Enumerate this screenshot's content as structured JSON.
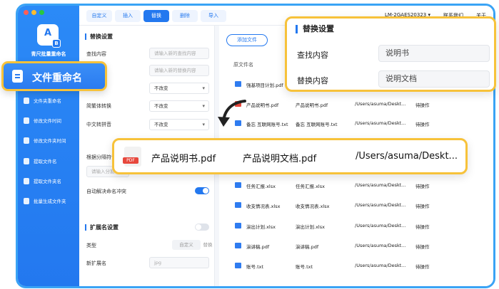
{
  "colors": {
    "accent": "#2378ef",
    "highlight": "#f7c23a",
    "frame": "#3aa3f5",
    "pdf": "#e7483d"
  },
  "window": {
    "dots": [
      "#ff5f57",
      "#febc2e",
      "#28c840"
    ]
  },
  "sidebar": {
    "app_name": "青尺批量重命名",
    "logo_letter": "A",
    "logo_sub": "B",
    "items": [
      {
        "label": "文件夹重命名",
        "icon": "folder-icon"
      },
      {
        "label": "修改文件时间",
        "icon": "clock-icon"
      },
      {
        "label": "修改文件夹时间",
        "icon": "clock-icon"
      },
      {
        "label": "提取文件名",
        "icon": "extract-icon"
      },
      {
        "label": "提取文件夹名",
        "icon": "extract-icon"
      },
      {
        "label": "批量生成文件夹",
        "icon": "folder-plus-icon"
      }
    ]
  },
  "topbar": {
    "tabs": [
      {
        "label": "自定义",
        "active": false
      },
      {
        "label": "插入",
        "active": false
      },
      {
        "label": "替换",
        "active": true
      },
      {
        "label": "删除",
        "active": false
      },
      {
        "label": "导入",
        "active": false
      }
    ],
    "device": "LM-2GAES20323",
    "contact": "联系我们",
    "about": "关于"
  },
  "settings": {
    "section_replace": "替换设置",
    "find_label": "查找内容",
    "find_placeholder": "请输入新的查找内容",
    "replace_placeholder": "请输入新的替换内容",
    "case_value": "不改变",
    "trad_label": "简繁体转换",
    "trad_value": "不改变",
    "pinyin_label": "中文转拼音",
    "pinyin_value": "不改变",
    "split_label": "根据分隔符调",
    "split_placeholder": "请输入分割",
    "auto_resolve_label": "自动解决命名冲突",
    "auto_resolve_on": true,
    "section_ext": "扩展名设置",
    "ext_enabled": false,
    "type_label": "类型",
    "type_options": [
      "自定义",
      "替换"
    ],
    "new_ext_label": "新扩展名",
    "new_ext_placeholder": "jpg"
  },
  "file_list": {
    "add_button": "添加文件",
    "header_original": "原文件名",
    "rows": [
      {
        "original": "强基项目计划.pdf",
        "new": "",
        "path": "",
        "status": "",
        "type": "folder"
      },
      {
        "original": "产品说明书.pdf",
        "new": "产品说明书.pdf",
        "path": "/Users/asuma/Deskt...",
        "status": "待操作",
        "type": "pdf"
      },
      {
        "original": "备忘 互联网账号.txt",
        "new": "备忘 互联网账号.txt",
        "path": "/Users/asuma/Deskt...",
        "status": "待操作",
        "type": "folder"
      },
      {
        "original": "任务汇报.xlsx",
        "new": "任务汇报.xlsx",
        "path": "/Users/asuma/Deskt...",
        "status": "待操作",
        "type": "folder"
      },
      {
        "original": "收支情况表.xlsx",
        "new": "收支情况表.xlsx",
        "path": "/Users/asuma/Deskt...",
        "status": "待操作",
        "type": "folder"
      },
      {
        "original": "演出计划.xlsx",
        "new": "演出计划.xlsx",
        "path": "/Users/asuma/Deskt...",
        "status": "待操作",
        "type": "folder"
      },
      {
        "original": "演讲稿.pdf",
        "new": "演讲稿.pdf",
        "path": "/Users/asuma/Deskt...",
        "status": "待操作",
        "type": "folder"
      },
      {
        "original": "账号.txt",
        "new": "账号.txt",
        "path": "/Users/asuma/Deskt...",
        "status": "待操作",
        "type": "folder"
      }
    ]
  },
  "callouts": {
    "feature": "文件重命名",
    "panel_title": "替换设置",
    "find_label": "查找内容",
    "find_value": "说明书",
    "replace_label": "替换内容",
    "replace_value": "说明文档",
    "result_original": "产品说明书.pdf",
    "result_new": "产品说明文档.pdf",
    "result_path": "/Users/asuma/Deskt..."
  }
}
